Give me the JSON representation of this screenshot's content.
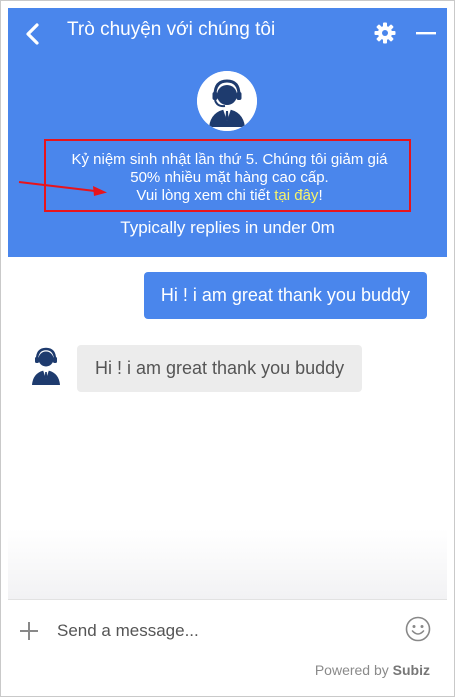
{
  "header": {
    "title": "Trò chuyện với chúng tôi",
    "notice": {
      "line1": "Kỷ niệm sinh nhật lần thứ 5. Chúng tôi giảm giá",
      "line2": "50% nhiều mặt hàng cao cấp.",
      "line3_prefix": "Vui lòng xem chi tiết ",
      "link_text": "tại đây",
      "line3_suffix": "!"
    },
    "reply_time": "Typically replies in under 0m"
  },
  "messages": [
    {
      "direction": "outgoing",
      "text": "Hi ! i am great thank you buddy"
    },
    {
      "direction": "incoming",
      "text": "Hi ! i am great thank you buddy"
    }
  ],
  "composer": {
    "placeholder": "Send a message..."
  },
  "footer": {
    "powered_prefix": "Powered by ",
    "brand": "Subiz"
  },
  "icons": [
    "back-icon",
    "gear-icon",
    "minimize-icon",
    "agent-avatar-icon",
    "plus-icon",
    "emoji-icon"
  ],
  "colors": {
    "header": "#4a86ec",
    "outgoing_bubble": "#4a86ec",
    "incoming_bubble": "#ececec",
    "highlight_box": "#e8141b",
    "link": "#f7f36a"
  }
}
